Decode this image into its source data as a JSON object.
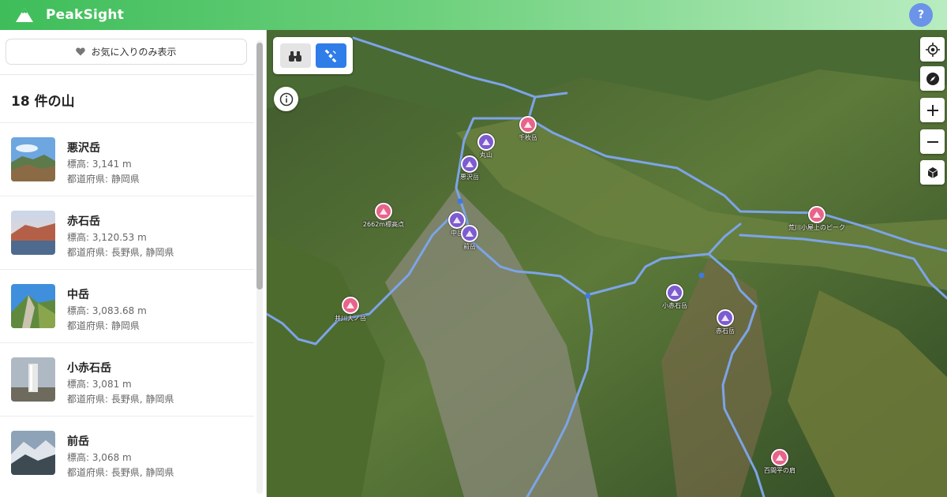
{
  "app": {
    "name": "PeakSight",
    "help_label": "?"
  },
  "sidebar": {
    "favorites_button": "お気に入りのみ表示",
    "count_title": "18 件の山",
    "items": [
      {
        "name": "悪沢岳",
        "elevation": "標高: 3,141 m",
        "prefecture": "都道府県: 静岡県"
      },
      {
        "name": "赤石岳",
        "elevation": "標高: 3,120.53 m",
        "prefecture": "都道府県: 長野県, 静岡県"
      },
      {
        "name": "中岳",
        "elevation": "標高: 3,083.68 m",
        "prefecture": "都道府県: 静岡県"
      },
      {
        "name": "小赤石岳",
        "elevation": "標高: 3,081 m",
        "prefecture": "都道府県: 長野県, 静岡県"
      },
      {
        "name": "前岳",
        "elevation": "標高: 3,068 m",
        "prefecture": "都道府県: 長野県, 静岡県"
      }
    ]
  },
  "map": {
    "view_modes": [
      {
        "icon": "binoculars-icon",
        "active": false
      },
      {
        "icon": "satellite-icon",
        "active": true
      }
    ],
    "controls": [
      "locate-icon",
      "compass-icon",
      "zoom-in-icon",
      "zoom-out-icon",
      "3d-cube-icon"
    ],
    "markers": [
      {
        "label": "千枚岳",
        "color": "pink"
      },
      {
        "label": "丸山",
        "color": "purple"
      },
      {
        "label": "悪沢岳",
        "color": "purple"
      },
      {
        "label": "2662m標高点",
        "color": "pink"
      },
      {
        "label": "中岳",
        "color": "purple"
      },
      {
        "label": "前岳",
        "color": "purple"
      },
      {
        "label": "荒川小屋上のピーク",
        "color": "pink"
      },
      {
        "label": "井川大ノ岳",
        "color": "pink"
      },
      {
        "label": "小赤石岳",
        "color": "purple"
      },
      {
        "label": "赤石岳",
        "color": "purple"
      },
      {
        "label": "百間平の肩",
        "color": "pink"
      }
    ]
  },
  "colors": {
    "marker_pink": "#e8638a",
    "marker_purple": "#7d5bd0",
    "accent_blue": "#2f7de8",
    "brand_green": "#3ebd5a"
  }
}
